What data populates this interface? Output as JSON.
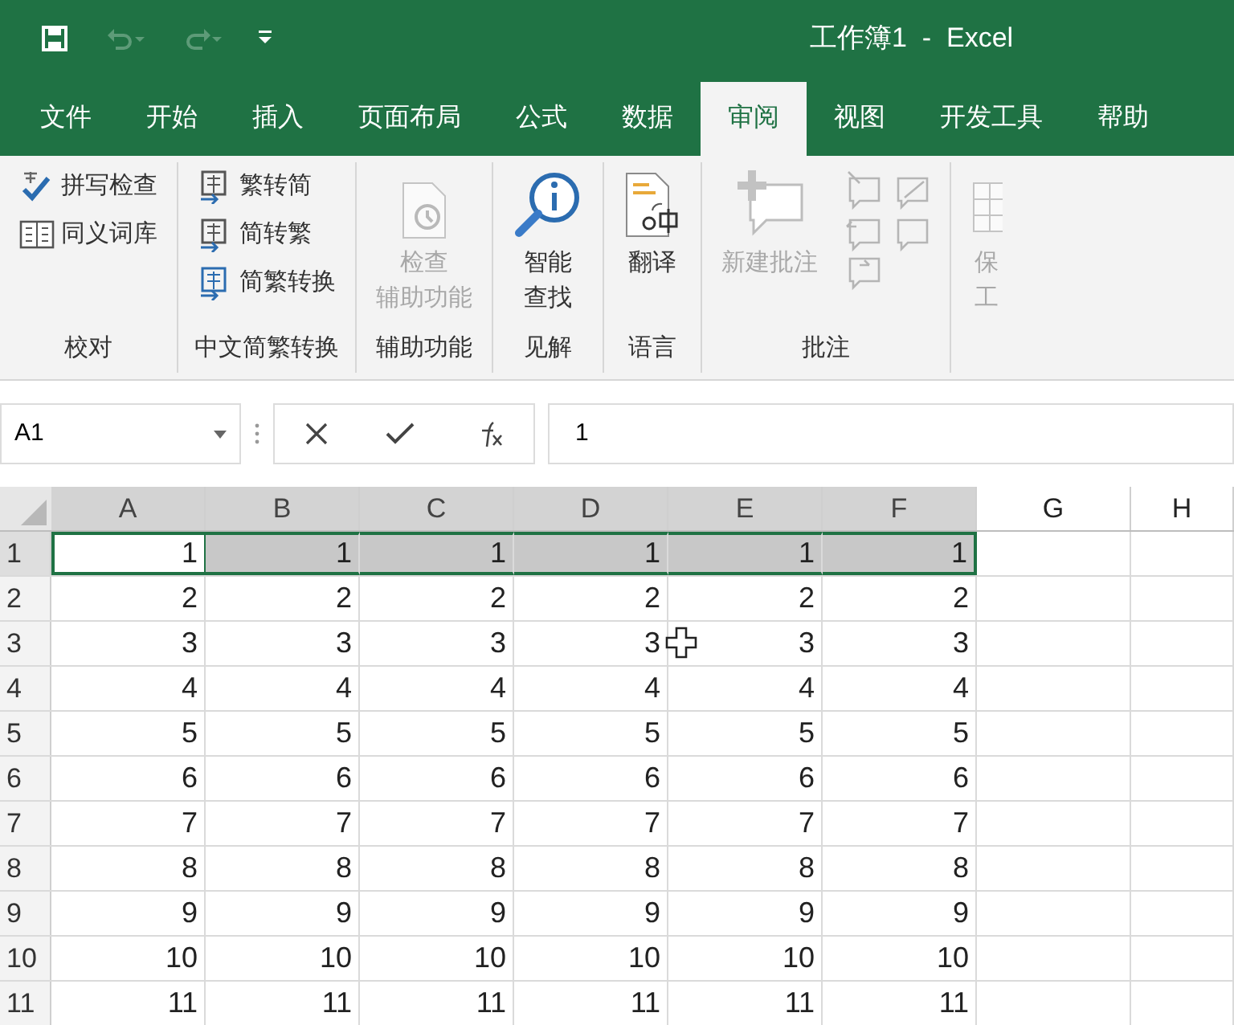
{
  "quick_access": [
    {
      "kind": "save",
      "disabled": false
    },
    {
      "kind": "undo",
      "disabled": true
    },
    {
      "kind": "redo",
      "disabled": true
    },
    {
      "kind": "customize",
      "disabled": false
    }
  ],
  "title": "工作簿1  -  Excel",
  "tabs": [
    {
      "label": "文件",
      "selected": false
    },
    {
      "label": "开始",
      "selected": false
    },
    {
      "label": "插入",
      "selected": false
    },
    {
      "label": "页面布局",
      "selected": false
    },
    {
      "label": "公式",
      "selected": false
    },
    {
      "label": "数据",
      "selected": false
    },
    {
      "label": "审阅",
      "selected": true
    },
    {
      "label": "视图",
      "selected": false
    },
    {
      "label": "开发工具",
      "selected": false
    },
    {
      "label": "帮助",
      "selected": false
    }
  ],
  "ribbon_groups": [
    {
      "label": "校对",
      "items": [
        {
          "kind": "small",
          "lines": [
            "拼写检查"
          ],
          "disabled": false
        },
        {
          "kind": "small",
          "lines": [
            "同义词库"
          ],
          "disabled": false
        }
      ]
    },
    {
      "label": "中文简繁转换",
      "items": [
        {
          "kind": "small",
          "lines": [
            "繁转简"
          ],
          "disabled": false
        },
        {
          "kind": "small",
          "lines": [
            "简转繁"
          ],
          "disabled": false
        },
        {
          "kind": "small",
          "lines": [
            "简繁转换"
          ],
          "disabled": false
        }
      ]
    },
    {
      "label": "辅助功能",
      "items": [
        {
          "kind": "large",
          "lines": [
            "检查",
            "辅助功能"
          ],
          "disabled": true
        }
      ]
    },
    {
      "label": "见解",
      "items": [
        {
          "kind": "large",
          "lines": [
            "智能",
            "查找"
          ],
          "disabled": false
        }
      ]
    },
    {
      "label": "语言",
      "items": [
        {
          "kind": "large",
          "lines": [
            "翻译"
          ],
          "disabled": false
        }
      ]
    },
    {
      "label": "批注",
      "items": [
        {
          "kind": "large",
          "lines": [
            "新建批注"
          ],
          "disabled": true
        },
        {
          "kind": "icons",
          "disabled": true
        }
      ]
    },
    {
      "items": [
        {
          "kind": "large",
          "lines": [
            "保",
            "工"
          ],
          "disabled": true
        }
      ]
    }
  ],
  "name_box": "A1",
  "formula": "1",
  "columns": [
    {
      "label": "A",
      "selected": true
    },
    {
      "label": "B",
      "selected": true
    },
    {
      "label": "C",
      "selected": true
    },
    {
      "label": "D",
      "selected": true
    },
    {
      "label": "E",
      "selected": true
    },
    {
      "label": "F",
      "selected": true
    },
    {
      "label": "G",
      "selected": false
    },
    {
      "label": "H",
      "selected": false
    }
  ],
  "rows": [
    {
      "label": "1",
      "selected": true,
      "cells": [
        "1",
        "1",
        "1",
        "1",
        "1",
        "1"
      ]
    },
    {
      "label": "2",
      "selected": false,
      "cells": [
        "2",
        "2",
        "2",
        "2",
        "2",
        "2"
      ]
    },
    {
      "label": "3",
      "selected": false,
      "cells": [
        "3",
        "3",
        "3",
        "3",
        "3",
        "3"
      ]
    },
    {
      "label": "4",
      "selected": false,
      "cells": [
        "4",
        "4",
        "4",
        "4",
        "4",
        "4"
      ]
    },
    {
      "label": "5",
      "selected": false,
      "cells": [
        "5",
        "5",
        "5",
        "5",
        "5",
        "5"
      ]
    },
    {
      "label": "6",
      "selected": false,
      "cells": [
        "6",
        "6",
        "6",
        "6",
        "6",
        "6"
      ]
    },
    {
      "label": "7",
      "selected": false,
      "cells": [
        "7",
        "7",
        "7",
        "7",
        "7",
        "7"
      ]
    },
    {
      "label": "8",
      "selected": false,
      "cells": [
        "8",
        "8",
        "8",
        "8",
        "8",
        "8"
      ]
    },
    {
      "label": "9",
      "selected": false,
      "cells": [
        "9",
        "9",
        "9",
        "9",
        "9",
        "9"
      ]
    },
    {
      "label": "10",
      "selected": false,
      "cells": [
        "10",
        "10",
        "10",
        "10",
        "10",
        "10"
      ]
    },
    {
      "label": "11",
      "selected": false,
      "cells": [
        "11",
        "11",
        "11",
        "11",
        "11",
        "11"
      ]
    }
  ]
}
